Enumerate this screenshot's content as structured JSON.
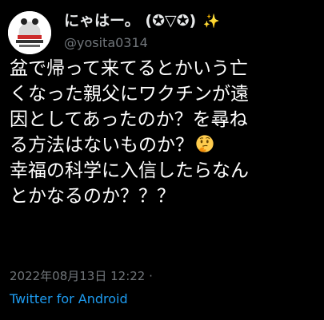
{
  "author": {
    "display_name": "にゃはー。 (✪▽✪)",
    "sparkle_glyph": "✨",
    "handle": "@yosita0314",
    "avatar_icon": "anime-avatar-icon"
  },
  "tweet": {
    "lines": [
      "盆で帰って来てるとかいう亡",
      "くなった親父にワクチンが遠",
      "因としてあったのか？を尋ね",
      "る方法はないものか？",
      "幸福の科学に入信したらなん",
      "とかなるのか？？？"
    ],
    "emoji_icon": "thinking-face-emoji"
  },
  "meta": {
    "timestamp": "2022年08月13日 12:22 ·",
    "source": "Twitter for Android"
  },
  "colors": {
    "background": "#000000",
    "text": "#ffffff",
    "secondary": "#71767b",
    "link": "#1d9bf0"
  }
}
